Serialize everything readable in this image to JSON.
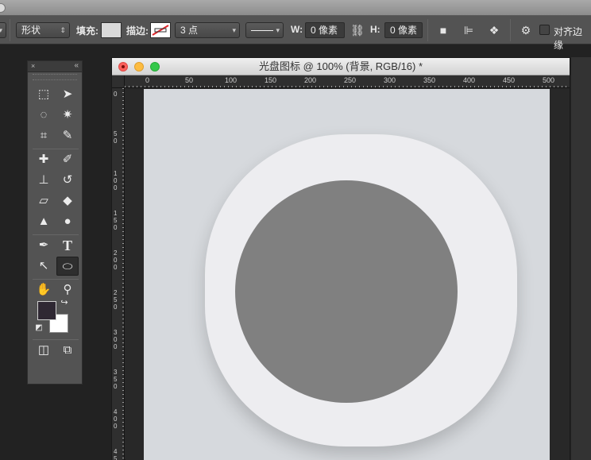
{
  "options_bar": {
    "shape_mode": "形状",
    "fill_label": "填充:",
    "stroke_label": "描边:",
    "stroke_width": "3 点",
    "w_label": "W:",
    "w_value": "0 像素",
    "h_label": "H:",
    "h_value": "0 像素",
    "align_edges_label": "对齐边缘"
  },
  "document": {
    "title": "光盘图标 @ 100% (背景, RGB/16) *",
    "ruler_h_labels": [
      "0",
      "50",
      "100",
      "150",
      "200",
      "250",
      "300",
      "350",
      "400",
      "450",
      "500"
    ],
    "ruler_v_labels": [
      "0",
      "5\n0",
      "1\n0\n0",
      "1\n5\n0",
      "2\n0\n0",
      "2\n5\n0",
      "3\n0\n0",
      "3\n5\n0",
      "4\n0\n0",
      "4\n5"
    ]
  },
  "tools_panel": {
    "close_glyph": "×",
    "collapse_glyph": "«"
  },
  "colors": {
    "foreground": "#2f2833",
    "background": "#ffffff",
    "icon_background": "#ededf0",
    "disc": "#808080",
    "canvas": "#d6d9dd"
  }
}
